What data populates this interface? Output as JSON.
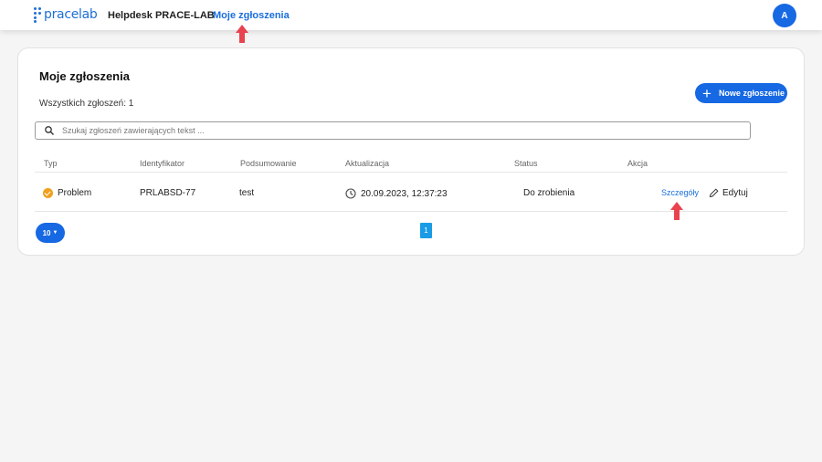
{
  "nav": {
    "logo": "pracelab",
    "helpdesk": "Helpdesk PRACE-LAB",
    "my_requests": "Moje zgłoszenia",
    "avatar_initial": "A"
  },
  "main": {
    "title": "Moje zgłoszenia",
    "total": "Wszystkich zgłoszeń: 1",
    "new_button": "Nowe zgłoszenie",
    "search_placeholder": "Szukaj zgłoszeń zawierających tekst ..."
  },
  "table": {
    "headers": [
      "Typ",
      "Identyfikator",
      "Podsumowanie",
      "Aktualizacja",
      "Status",
      "Akcja"
    ],
    "rows": [
      {
        "type": "Problem",
        "id": "PRLABSD-77",
        "summary": "test",
        "updated": "20.09.2023, 12:37:23",
        "status": "Do zrobienia",
        "details": "Szczegóły",
        "edit": "Edytuj"
      }
    ]
  },
  "pagination": {
    "page_size": "10",
    "current_page": "1"
  },
  "colors": {
    "accent": "#1668e3",
    "link": "#1a6fdc",
    "annotation_arrow": "#e8434f",
    "type_icon": "#f0a020",
    "page_active": "#1a9be6"
  }
}
